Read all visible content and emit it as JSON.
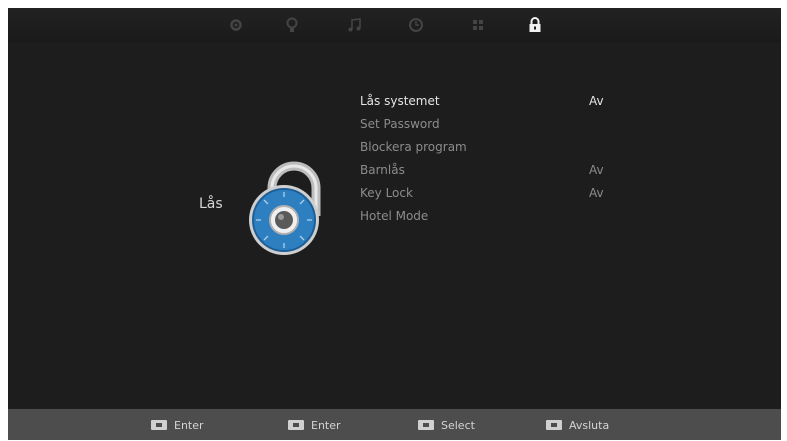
{
  "tabs": [
    {
      "icon": "gear-icon"
    },
    {
      "icon": "picture-icon"
    },
    {
      "icon": "music-note-icon"
    },
    {
      "icon": "clock-icon"
    },
    {
      "icon": "channel-grid-icon"
    },
    {
      "icon": "lock-icon",
      "active": true
    }
  ],
  "section": {
    "title": "Lås",
    "icon": "combination-padlock-icon"
  },
  "menu": {
    "items": [
      {
        "label": "Lås systemet",
        "value": "Av"
      },
      {
        "label": "Set Password",
        "value": ""
      },
      {
        "label": "Blockera program",
        "value": ""
      },
      {
        "label": "Barnlås",
        "value": "Av"
      },
      {
        "label": "Key Lock",
        "value": "Av"
      },
      {
        "label": "Hotel Mode",
        "value": ""
      }
    ]
  },
  "footer": {
    "hints": [
      {
        "label": "Enter"
      },
      {
        "label": "Enter"
      },
      {
        "label": "Select"
      },
      {
        "label": "Avsluta"
      }
    ]
  },
  "colors": {
    "background": "#1d1d1d",
    "bottom_bar": "#4d4d4d",
    "accent_blue": "#2e7fc0"
  }
}
